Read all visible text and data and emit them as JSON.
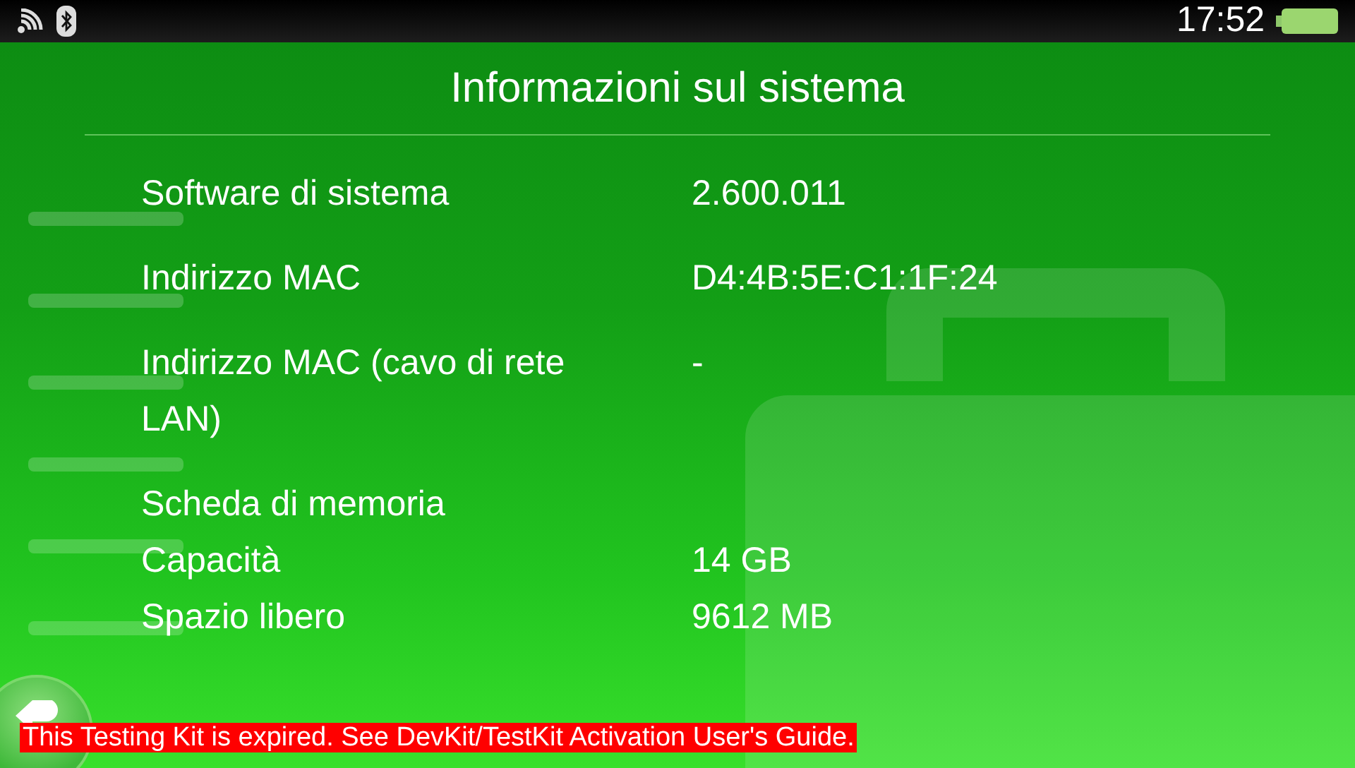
{
  "status_bar": {
    "time": "17:52"
  },
  "title": "Informazioni sul sistema",
  "rows": [
    {
      "kind": "item",
      "label": "Software di sistema",
      "value": "2.600.011"
    },
    {
      "kind": "item",
      "label": "Indirizzo MAC",
      "value": "D4:4B:5E:C1:1F:24"
    },
    {
      "kind": "item",
      "label": "Indirizzo MAC (cavo di rete LAN)",
      "value": "-"
    },
    {
      "kind": "section",
      "label": "Scheda di memoria",
      "children": [
        {
          "label": "Capacità",
          "value": "14 GB"
        },
        {
          "label": "Spazio libero",
          "value": "9612 MB"
        }
      ]
    }
  ],
  "banner": "This Testing Kit is expired. See DevKit/TestKit Activation User's Guide."
}
